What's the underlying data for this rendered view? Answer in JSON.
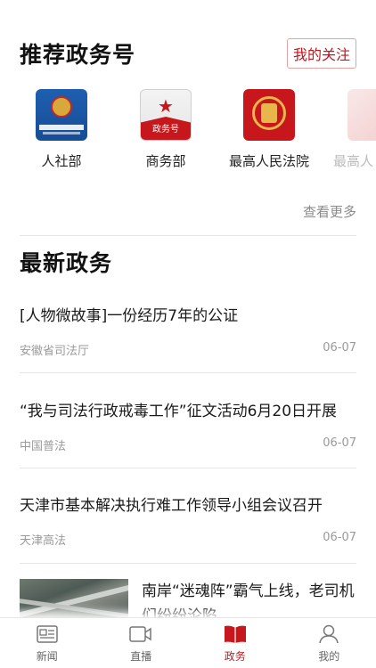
{
  "recommend": {
    "title": "推荐政务号",
    "follow_label": "我的关注",
    "accounts": [
      {
        "name": "人社部",
        "icon": "hrss-logo-icon"
      },
      {
        "name": "商务部",
        "icon": "mofcom-logo-icon",
        "badge": "政务号"
      },
      {
        "name": "最高人民法院",
        "icon": "court-logo-icon"
      },
      {
        "name": "最高人",
        "icon": "procuratorate-logo-icon"
      }
    ],
    "see_more": "查看更多"
  },
  "latest": {
    "title": "最新政务",
    "items": [
      {
        "headline": "[人物微故事]一份经历7年的公证",
        "source": "安徽省司法厅",
        "date": "06-07"
      },
      {
        "headline": "“我与司法行政戒毒工作”征文活动6月20日开展",
        "source": "中国普法",
        "date": "06-07"
      },
      {
        "headline": "天津市基本解决执行难工作领导小组会议召开",
        "source": "天津高法",
        "date": "06-07"
      }
    ],
    "image_item": {
      "headline": "南岸“迷魂阵”霸气上线，老司机们纷纷沦陷"
    }
  },
  "tabbar": {
    "tabs": [
      {
        "label": "新闻",
        "icon": "news-icon"
      },
      {
        "label": "直播",
        "icon": "video-icon"
      },
      {
        "label": "政务",
        "icon": "book-icon",
        "active": true
      },
      {
        "label": "我的",
        "icon": "user-icon"
      }
    ]
  },
  "colors": {
    "accent": "#c8161d",
    "secondary_text": "#9a9a9a"
  }
}
